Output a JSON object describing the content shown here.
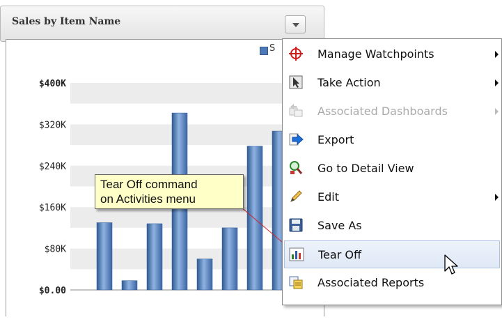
{
  "panel": {
    "title": "Sales by Item Name"
  },
  "chart_data": {
    "type": "bar",
    "title": "Sales by Item Name",
    "legend": "S",
    "y_tick_labels": [
      "$400K",
      "$320K",
      "$240K",
      "$160K",
      "$80K",
      "$0.00"
    ],
    "y_ticks": [
      400000,
      320000,
      240000,
      160000,
      80000,
      0
    ],
    "ylim": [
      0,
      400000
    ],
    "grid": true,
    "values": [
      130000,
      18000,
      128000,
      342000,
      60000,
      120000,
      278000,
      307000
    ],
    "color": "#4d79b8"
  },
  "callout": {
    "line1": "Tear Off command",
    "line2": "on Activities menu"
  },
  "menu": {
    "items": [
      {
        "label": "Manage Watchpoints",
        "icon": "crosshair-icon",
        "submenu": true,
        "disabled": false
      },
      {
        "label": "Take Action",
        "icon": "action-cursor-icon",
        "submenu": true,
        "disabled": false
      },
      {
        "label": "Associated Dashboards",
        "icon": "dashboards-icon",
        "submenu": true,
        "disabled": true
      },
      {
        "label": "Export",
        "icon": "export-arrow-icon",
        "submenu": false,
        "disabled": false
      },
      {
        "label": "Go to Detail View",
        "icon": "detail-view-icon",
        "submenu": false,
        "disabled": false
      },
      {
        "label": "Edit",
        "icon": "pencil-icon",
        "submenu": true,
        "disabled": false
      },
      {
        "label": "Save As",
        "icon": "floppy-disk-icon",
        "submenu": false,
        "disabled": false
      },
      {
        "label": "Tear Off",
        "icon": "tear-off-chart-icon",
        "submenu": false,
        "disabled": false,
        "highlighted": true
      },
      {
        "label": "Associated Reports",
        "icon": "reports-icon",
        "submenu": false,
        "disabled": false
      }
    ]
  }
}
